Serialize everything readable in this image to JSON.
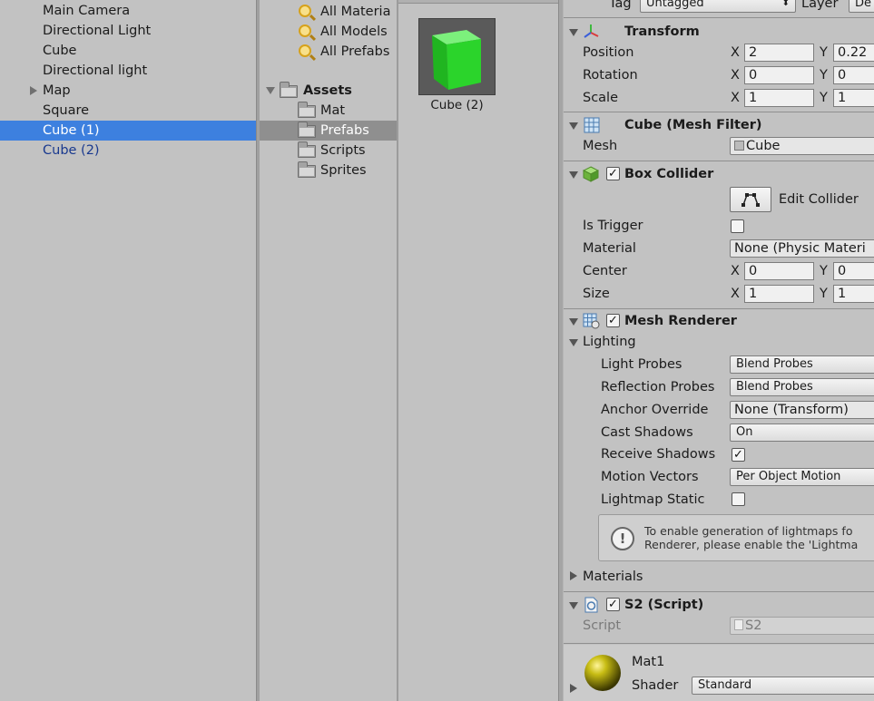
{
  "hierarchy": {
    "items": [
      {
        "label": "Main Camera"
      },
      {
        "label": "Directional Light"
      },
      {
        "label": "Cube"
      },
      {
        "label": "Directional light"
      },
      {
        "label": "Map"
      },
      {
        "label": "Square"
      },
      {
        "label": "Cube (1)"
      },
      {
        "label": "Cube (2)"
      }
    ],
    "selected": "Cube (1)"
  },
  "project": {
    "favorites": [
      {
        "label": "All Materia"
      },
      {
        "label": "All Models"
      },
      {
        "label": "All Prefabs"
      }
    ],
    "assets_label": "Assets",
    "folders": [
      {
        "label": "Mat"
      },
      {
        "label": "Prefabs"
      },
      {
        "label": "Scripts"
      },
      {
        "label": "Sprites"
      }
    ],
    "selected_folder": "Prefabs",
    "grid": {
      "item_label": "Cube (2)",
      "thumb_color": "#2bd42b"
    }
  },
  "inspector": {
    "tag_label": "Tag",
    "tag_value": "Untagged",
    "layer_label": "Layer",
    "layer_value": "De",
    "transform": {
      "title": "Transform",
      "position_label": "Position",
      "rotation_label": "Rotation",
      "scale_label": "Scale",
      "x_label": "X",
      "y_label": "Y",
      "position": {
        "x": "2",
        "y": "0.22"
      },
      "rotation": {
        "x": "0",
        "y": "0"
      },
      "scale": {
        "x": "1",
        "y": "1"
      }
    },
    "mesh_filter": {
      "title": "Cube (Mesh Filter)",
      "mesh_label": "Mesh",
      "mesh_value": "Cube"
    },
    "box_collider": {
      "title": "Box Collider",
      "edit_label": "Edit Collider",
      "trigger_label": "Is Trigger",
      "material_label": "Material",
      "material_value": "None (Physic Materi",
      "center_label": "Center",
      "size_label": "Size",
      "center": {
        "x": "0",
        "y": "0"
      },
      "size": {
        "x": "1",
        "y": "1"
      }
    },
    "mesh_renderer": {
      "title": "Mesh Renderer",
      "lighting_label": "Lighting",
      "light_probes_label": "Light Probes",
      "light_probes_value": "Blend Probes",
      "reflection_label": "Reflection Probes",
      "reflection_value": "Blend Probes",
      "anchor_label": "Anchor Override",
      "anchor_value": "None (Transform)",
      "cast_label": "Cast Shadows",
      "cast_value": "On",
      "receive_label": "Receive Shadows",
      "motion_label": "Motion Vectors",
      "motion_value": "Per Object Motion",
      "lightmap_label": "Lightmap Static",
      "info_line1": "To enable generation of lightmaps fo",
      "info_line2": "Renderer, please enable the 'Lightma",
      "materials_label": "Materials"
    },
    "script": {
      "title": "S2 (Script)",
      "script_label": "Script",
      "script_value": "S2"
    },
    "material": {
      "name": "Mat1",
      "shader_label": "Shader",
      "shader_value": "Standard"
    }
  },
  "colors": {
    "selection": "#3d80df",
    "prefab_text": "#1a3a8f",
    "panel_bg": "#c2c2c2"
  }
}
